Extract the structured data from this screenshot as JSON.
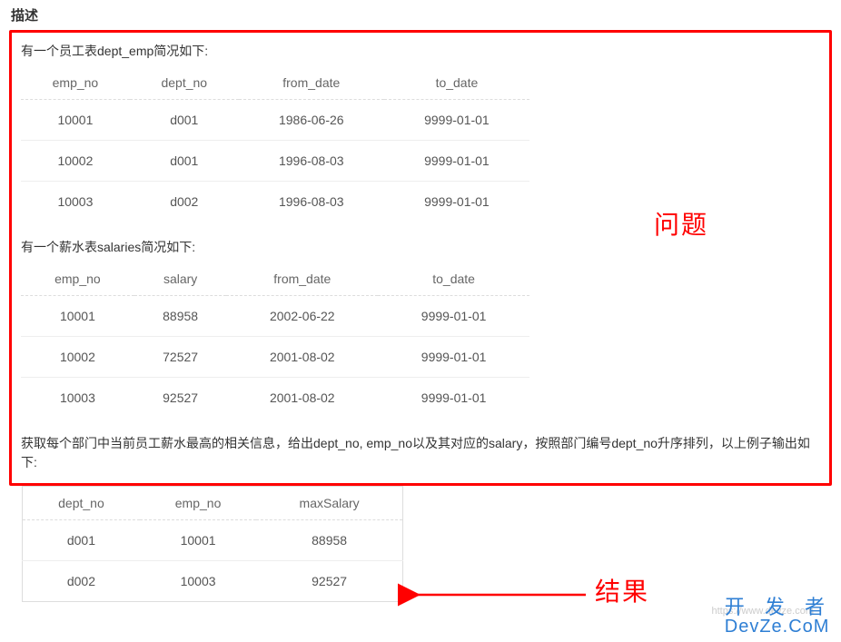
{
  "heading": "描述",
  "section1": {
    "intro": "有一个员工表dept_emp简况如下:",
    "headers": [
      "emp_no",
      "dept_no",
      "from_date",
      "to_date"
    ],
    "rows": [
      [
        "10001",
        "d001",
        "1986-06-26",
        "9999-01-01"
      ],
      [
        "10002",
        "d001",
        "1996-08-03",
        "9999-01-01"
      ],
      [
        "10003",
        "d002",
        "1996-08-03",
        "9999-01-01"
      ]
    ]
  },
  "section2": {
    "intro": "有一个薪水表salaries简况如下:",
    "headers": [
      "emp_no",
      "salary",
      "from_date",
      "to_date"
    ],
    "rows": [
      [
        "10001",
        "88958",
        "2002-06-22",
        "9999-01-01"
      ],
      [
        "10002",
        "72527",
        "2001-08-02",
        "9999-01-01"
      ],
      [
        "10003",
        "92527",
        "2001-08-02",
        "9999-01-01"
      ]
    ]
  },
  "task_text": "获取每个部门中当前员工薪水最高的相关信息，给出dept_no, emp_no以及其对应的salary，按照部门编号dept_no升序排列，以上例子输出如下:",
  "result": {
    "headers": [
      "dept_no",
      "emp_no",
      "maxSalary"
    ],
    "rows": [
      [
        "d001",
        "10001",
        "88958"
      ],
      [
        "d002",
        "10003",
        "92527"
      ]
    ]
  },
  "annotations": {
    "question": "问题",
    "result": "结果"
  },
  "watermark": {
    "line1": "开 发 者",
    "line2": "DevZe.CoM",
    "faint": "https://www.devze.com"
  }
}
